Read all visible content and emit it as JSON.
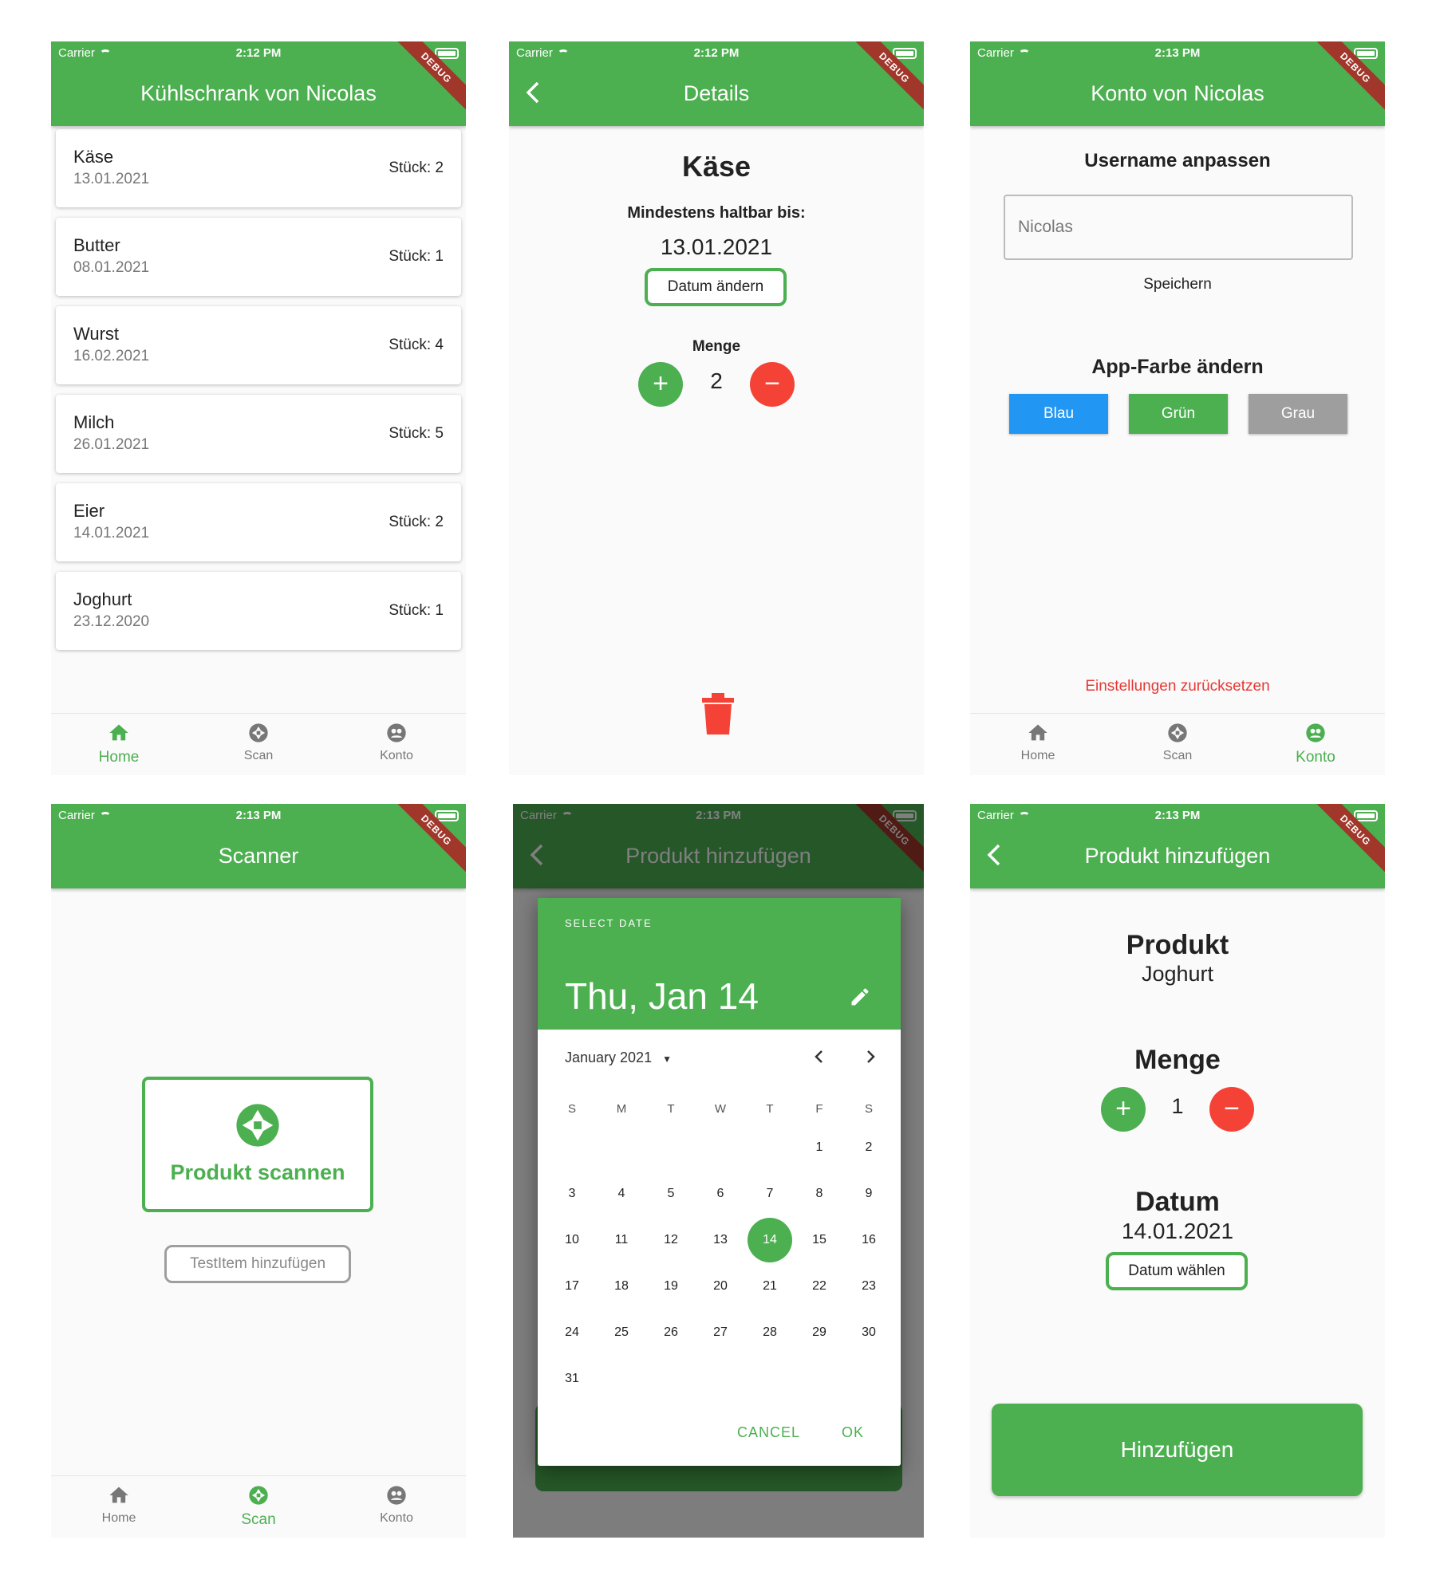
{
  "status": {
    "carrier": "Carrier",
    "debug": "DEBUG",
    "time_a": "2:12 PM",
    "time_b": "2:13 PM"
  },
  "colors": {
    "primary": "#4caf50",
    "danger": "#f44336",
    "blue": "#2196f3",
    "grey": "#9e9e9e"
  },
  "nav": {
    "home": "Home",
    "scan": "Scan",
    "konto": "Konto"
  },
  "fridge": {
    "title": "Kühlschrank von Nicolas",
    "items": [
      {
        "name": "Käse",
        "date": "13.01.2021",
        "qty": "Stück: 2"
      },
      {
        "name": "Butter",
        "date": "08.01.2021",
        "qty": "Stück: 1"
      },
      {
        "name": "Wurst",
        "date": "16.02.2021",
        "qty": "Stück: 4"
      },
      {
        "name": "Milch",
        "date": "26.01.2021",
        "qty": "Stück: 5"
      },
      {
        "name": "Eier",
        "date": "14.01.2021",
        "qty": "Stück: 2"
      },
      {
        "name": "Joghurt",
        "date": "23.12.2020",
        "qty": "Stück: 1"
      }
    ]
  },
  "details": {
    "title": "Details",
    "product": "Käse",
    "mhd_label": "Mindestens haltbar bis:",
    "mhd_value": "13.01.2021",
    "change_date": "Datum ändern",
    "amount_label": "Menge",
    "amount": "2"
  },
  "account": {
    "title": "Konto von Nicolas",
    "username_heading": "Username anpassen",
    "username_value": "Nicolas",
    "save": "Speichern",
    "color_heading": "App-Farbe ändern",
    "color_buttons": [
      "Blau",
      "Grün",
      "Grau"
    ],
    "reset": "Einstellungen zurücksetzen"
  },
  "scanner": {
    "title": "Scanner",
    "scan_button": "Produkt scannen",
    "test_button": "TestItem hinzufügen"
  },
  "datepicker": {
    "page_title": "Produkt hinzufügen",
    "select_date": "SELECT DATE",
    "selected": "Thu, Jan 14",
    "month": "January 2021",
    "weekdays": [
      "S",
      "M",
      "T",
      "W",
      "T",
      "F",
      "S"
    ],
    "weeks": [
      [
        "",
        "",
        "",
        "",
        "",
        "1",
        "2"
      ],
      [
        "3",
        "4",
        "5",
        "6",
        "7",
        "8",
        "9"
      ],
      [
        "10",
        "11",
        "12",
        "13",
        "14",
        "15",
        "16"
      ],
      [
        "17",
        "18",
        "19",
        "20",
        "21",
        "22",
        "23"
      ],
      [
        "24",
        "25",
        "26",
        "27",
        "28",
        "29",
        "30"
      ],
      [
        "31",
        "",
        "",
        "",
        "",
        "",
        ""
      ]
    ],
    "selected_day": "14",
    "cancel": "CANCEL",
    "ok": "OK"
  },
  "add_product": {
    "title": "Produkt hinzufügen",
    "product_label": "Produkt",
    "product_value": "Joghurt",
    "amount_label": "Menge",
    "amount": "1",
    "date_label": "Datum",
    "date_value": "14.01.2021",
    "choose_date": "Datum wählen",
    "submit": "Hinzufügen"
  }
}
